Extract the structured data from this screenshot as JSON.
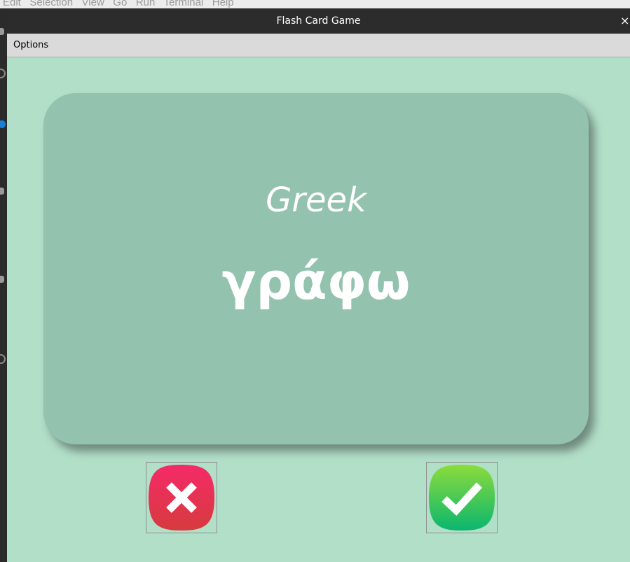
{
  "background_editor": {
    "menu_text": "Edit   Selection   View   Go   Run   Terminal   Help"
  },
  "window": {
    "title": "Flash Card Game",
    "close_label": "×"
  },
  "menubar": {
    "options_label": "Options"
  },
  "card": {
    "language": "Greek",
    "word": "γράφω"
  },
  "buttons": {
    "wrong_icon": "x-icon",
    "right_icon": "check-icon"
  },
  "colors": {
    "window_background": "#b2dfc8",
    "card_background": "#93c2ae",
    "wrong_button": "#e8395a",
    "right_button": "#2fc76a"
  }
}
